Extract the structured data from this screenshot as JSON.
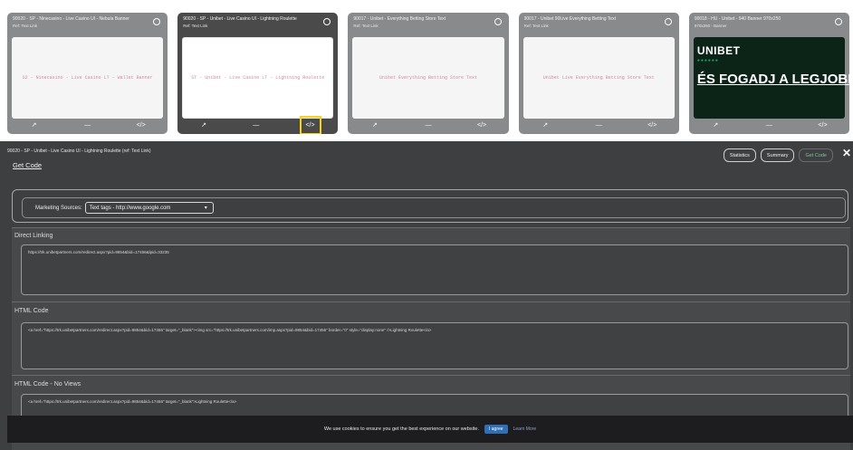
{
  "cards": [
    {
      "title": "90020 - SP - Ninecasino - Live Casino UI - Nebula Banner",
      "sub": "Ref: Text Link",
      "preview": "S2 - Ninecasino - Live Casino LT - Wallet Banner"
    },
    {
      "title": "90020 - SP - Unibet - Live Casino UI - Lightning Roulette",
      "sub": "Ref: Text Link",
      "preview": "ST - Unibet - Live Casino LT - Lightning Roulette"
    },
    {
      "title": "90017 - Unibet - Everything Betting Store Text",
      "sub": "Ref: Text Link",
      "preview": "Unibet Everything Betting Store Text"
    },
    {
      "title": "90017 - Unibet 90Live Everything Betting Text",
      "sub": "Ref: Text Link",
      "preview": "Unibet Live Everything Betting Store Text"
    },
    {
      "title": "90018 - HU - Unibet - 940 Banner 970x250",
      "sub": "970x250 - Banner",
      "logo": "UNIBET",
      "dots": "●●●●●●",
      "big": "ÉS FOGADJ A LEGJOBB"
    }
  ],
  "card_icons": {
    "stats": "↗",
    "dash": "—",
    "code": "</>"
  },
  "panel": {
    "title": "90020 - SP - Unibet - Live Casino UI - Lightning Roulette (ref: Text Link)",
    "subtitle": "Get Code",
    "buttons": [
      "Statistics",
      "Summary",
      "Get Code"
    ],
    "close": "✕"
  },
  "marketing": {
    "label": "Marketing Sources:",
    "selected": "Text tags - http://www.google.com"
  },
  "sections": [
    {
      "label": "Direct Linking",
      "code": "https://trk.unibetpartners.com/redirect.aspx?pid=9854&bid=17456&lpid=33235"
    },
    {
      "label": "HTML Code",
      "code": "<a href=\"https://trk.unibetpartners.com/redirect.aspx?pid=9854&bid=17456\" target=\"_blank\"><img src=\"https://trk.unibetpartners.com/imp.aspx?pid=9854&bid=17456\" border=\"0\" style=\"display:none\" />Lightning Roulette</a>"
    },
    {
      "label": "HTML Code - No Views",
      "code": "<a href=\"https://trk.unibetpartners.com/redirect.aspx?pid=9854&bid=17456\" target=\"_blank\">Lightning Roulette</a>"
    }
  ],
  "cookie": {
    "text": "We use cookies to ensure you get the best experience on our website.",
    "agree": "I agree",
    "learn": "Learn More"
  }
}
